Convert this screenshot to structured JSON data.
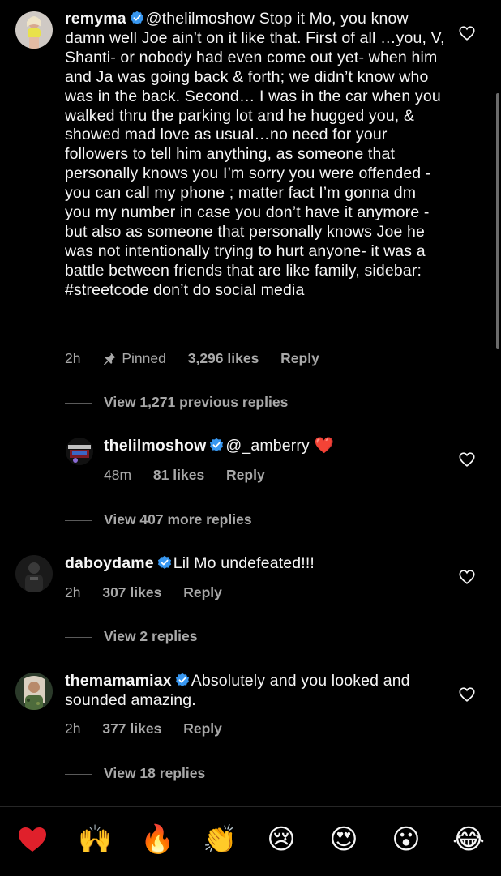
{
  "comments": [
    {
      "username": "remyma",
      "verified": true,
      "text": "@thelilmoshow Stop it Mo, you know damn well Joe ain’t on it like that. First of all …you, V, Shanti- or nobody had even come out yet- when him and Ja was going back & forth; we didn’t know who was in the back. Second… I was in the car when you walked thru the parking lot and he hugged you, & showed mad love as usual…no need for your followers to tell him anything, as someone that personally knows you I’m sorry you were offended - you can call my phone ; matter fact I’m gonna dm you my number in case you don’t have it anymore - but also as someone that personally knows Joe he was not intentionally trying to hurt anyone- it was a battle between friends that are like family, sidebar: #streetcode don’t do social media",
      "time": "2h",
      "pinned_label": "Pinned",
      "likes": "3,296 likes",
      "reply_label": "Reply",
      "view_replies": "View 1,271 previous replies"
    },
    {
      "username": "thelilmoshow",
      "verified": true,
      "text": "@_amberry",
      "emoji": "❤️",
      "time": "48m",
      "likes": "81 likes",
      "reply_label": "Reply",
      "view_replies": "View 407 more replies"
    },
    {
      "username": "daboydame",
      "verified": true,
      "text": "Lil Mo undefeated!!!",
      "time": "2h",
      "likes": "307 likes",
      "reply_label": "Reply",
      "view_replies": "View 2 replies"
    },
    {
      "username": "themamamiax",
      "verified": true,
      "text": "Absolutely and you looked and sounded amazing.",
      "time": "2h",
      "likes": "377 likes",
      "reply_label": "Reply",
      "view_replies": "View 18 replies"
    }
  ],
  "emoji_bar": [
    "❤️",
    "🙌",
    "🔥",
    "👏",
    "😢",
    "😍",
    "😮",
    "😂"
  ],
  "colors": {
    "background": "#000000",
    "text": "#f5f5f5",
    "secondary": "#a8a8a8",
    "verified": "#3897f0",
    "heart": "#ed4956"
  }
}
